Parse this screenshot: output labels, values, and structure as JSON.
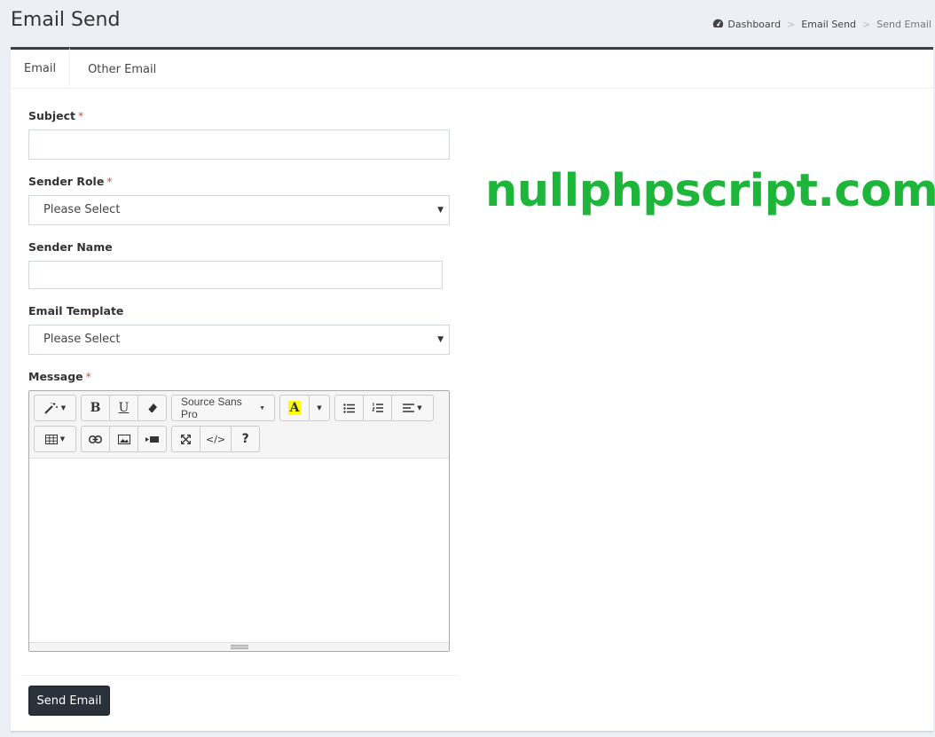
{
  "header": {
    "title": "Email Send",
    "breadcrumb": [
      "Dashboard",
      "Email Send",
      "Send Email"
    ],
    "breadcrumb_icon": "dashboard-icon"
  },
  "tabs": [
    {
      "label": "Email",
      "active": true
    },
    {
      "label": "Other Email",
      "active": false
    }
  ],
  "form": {
    "subject": {
      "label": "Subject",
      "required_mark": "*",
      "value": ""
    },
    "sender_role": {
      "label": "Sender Role",
      "required_mark": "*",
      "selected": "Please Select"
    },
    "sender_name": {
      "label": "Sender Name",
      "value": ""
    },
    "email_template": {
      "label": "Email Template",
      "selected": "Please Select"
    },
    "message": {
      "label": "Message",
      "required_mark": "*",
      "value": ""
    }
  },
  "editor": {
    "toolbar": {
      "bold": "B",
      "underline": "U",
      "font_name": "Source Sans Pro",
      "highlight": "A",
      "help": "?",
      "code": "</>"
    },
    "highlight_color": "#ffff00"
  },
  "actions": {
    "send_label": "Send Email"
  },
  "watermark": "nullphpscript.com",
  "colors": {
    "accent_dark": "#2b313a",
    "required": "#dd4b39",
    "watermark": "#1db53a"
  }
}
